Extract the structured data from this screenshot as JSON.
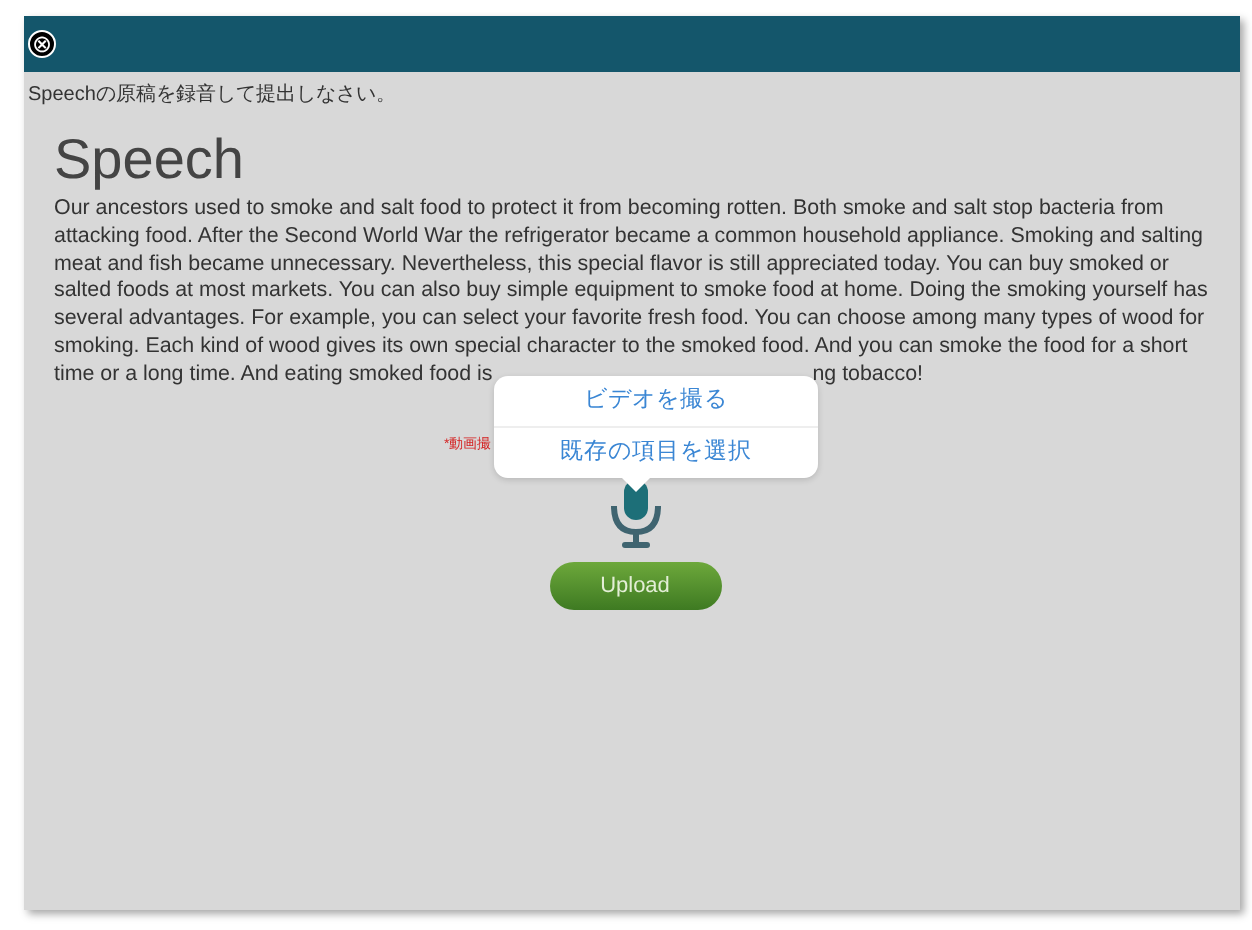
{
  "header": {
    "close_icon": "⊗"
  },
  "instruction": "Speechの原稿を録音して提出しなさい。",
  "title": "Speech",
  "paragraph": "Our ancestors used to smoke and salt food to protect it from becoming rotten. Both smoke and salt stop bacteria from attacking food. After the Second World War the refrigerator became a common household appliance. Smoking and salting meat and fish became unnecessary. Nevertheless, this special flavor is still appreciated today. You can buy smoked or salted foods at most markets. You can also buy simple equipment to smoke food at home. Doing the smoking yourself has several advantages. For example, you can select your favorite fresh food. You can choose among many types of wood for smoking. Each kind of wood gives its own special character to the smoked food. And you can smoke the food for a short time or a long time. And eating smoked food is",
  "paragraph_tail": "ng tobacco!",
  "note": "*動画撮",
  "upload_button": "Upload",
  "popover": {
    "items": [
      "ビデオを撮る",
      "既存の項目を選択"
    ]
  }
}
